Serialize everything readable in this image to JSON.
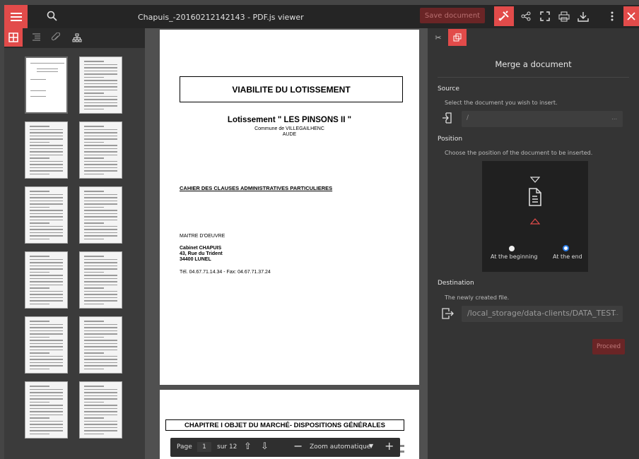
{
  "topbar": {
    "title": "Chapuis_-20160212142143 - PDF.js viewer",
    "save_label": "Save document",
    "icons": [
      "menu-icon",
      "search-icon",
      "tools-icon",
      "share-icon",
      "fullscreen-icon",
      "print-icon",
      "download-icon",
      "more-icon",
      "close-icon"
    ]
  },
  "sidebar": {
    "tools": [
      "thumbnails-icon",
      "outline-icon",
      "attachments-icon",
      "layers-icon"
    ]
  },
  "page1": {
    "heading": "VIABILITE DU LOTISSEMENT",
    "lot": "Lotissement \" LES PINSONS II \"",
    "commune": "Commune de VILLEGAILHENC",
    "dept": "AUDE",
    "cahier": "CAHIER DES CLAUSES ADMINISTRATIVES PARTICULIERES",
    "maitre": "MAITRE D'OEUVRE",
    "cab1": "Cabinet CHAPUIS",
    "cab2": "43, Rue du Trident",
    "cab3": "34400 LUNEL",
    "tel": "Tél. 04.67.71.14.34 - Fax: 04.67.71.37.24"
  },
  "page2": {
    "chapitre": "CHAPITRE I  OBJET DU MARCHÉ- DISPOSITIONS GÉNÉRALES"
  },
  "bottombar": {
    "page_label": "Page",
    "page_value": "1",
    "page_total": "sur 12",
    "zoom": "Zoom automatique"
  },
  "panel": {
    "title": "Merge a document",
    "source_label": "Source",
    "source_desc": "Select the document you wish to insert.",
    "source_value": "/",
    "source_more": "...",
    "position_label": "Position",
    "position_desc": "Choose the position of the document to be inserted.",
    "opt_begin": "At the beginning",
    "opt_end": "At the end",
    "selected_option": "At the end",
    "dest_label": "Destination",
    "dest_desc": "The newly created file.",
    "dest_value": "/local_storage/data-clients/DATA_TEST",
    "dest_more": "...",
    "proceed": "Proceed"
  },
  "colors": {
    "accent": "#e24b4a",
    "toolbar": "#252525",
    "panel": "#343434"
  }
}
